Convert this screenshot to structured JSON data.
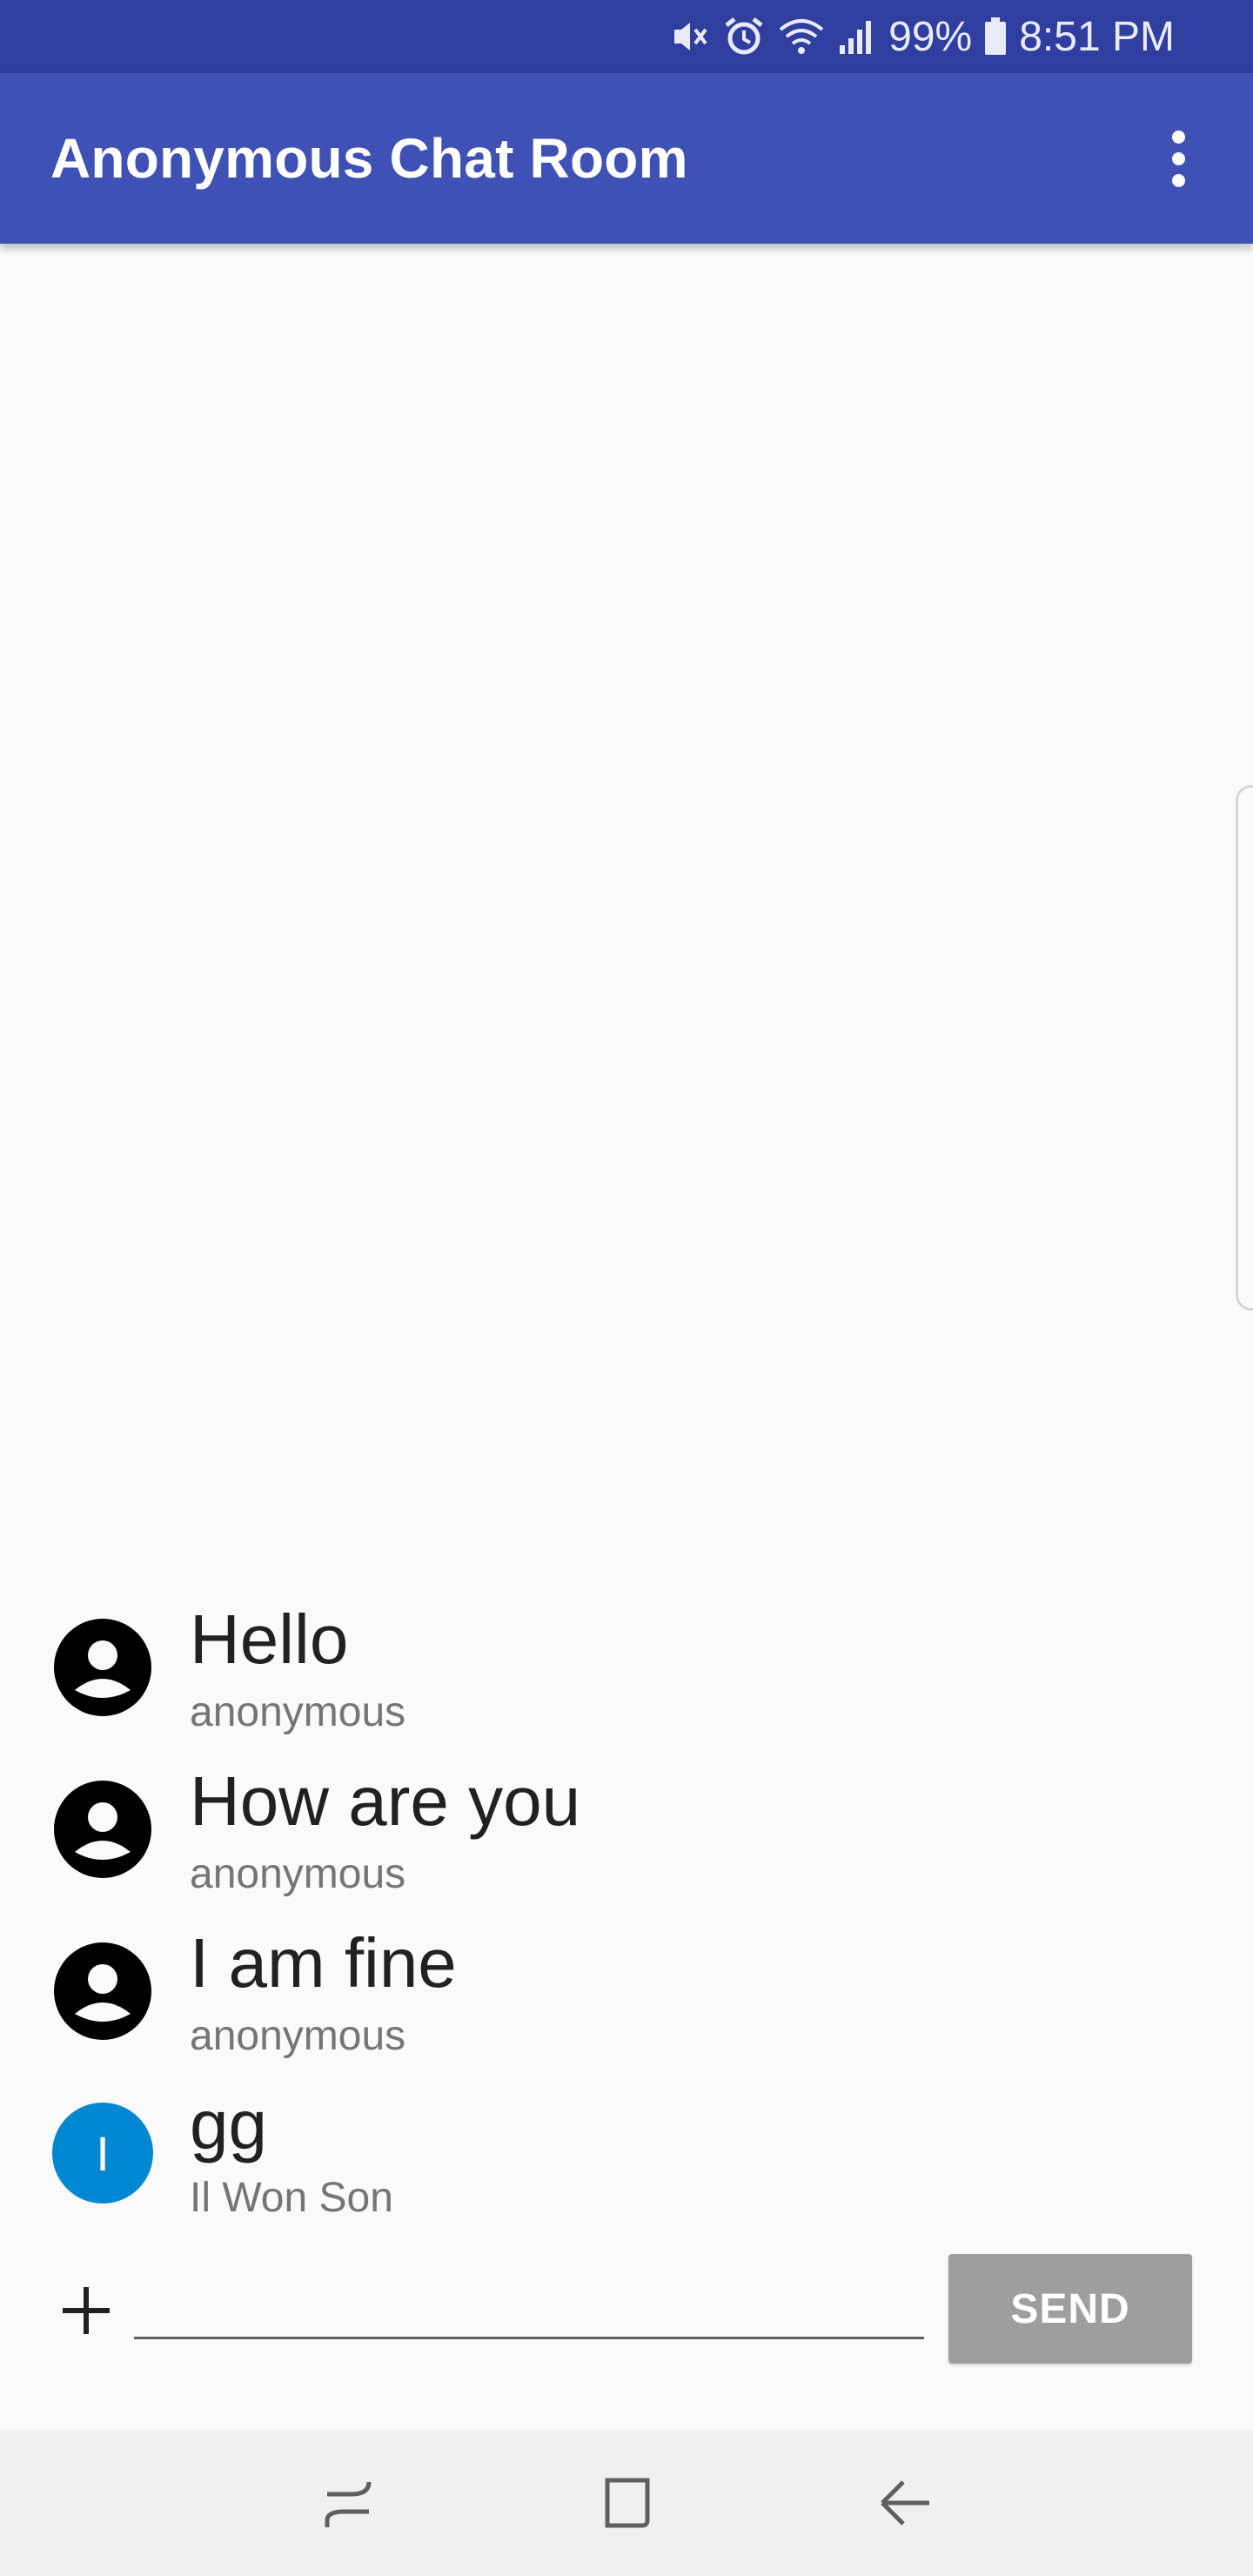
{
  "status_bar": {
    "battery_percent": "99%",
    "time": "8:51 PM",
    "icons": [
      "vibrate-mute-icon",
      "alarm-icon",
      "wifi-icon",
      "signal-icon",
      "battery-icon"
    ]
  },
  "app_bar": {
    "title": "Anonymous Chat Room",
    "menu_icon": "overflow-menu-icon"
  },
  "messages": [
    {
      "text": "Hello",
      "author": "anonymous",
      "avatar": "account-circle-icon"
    },
    {
      "text": "How are you",
      "author": "anonymous",
      "avatar": "account-circle-icon"
    },
    {
      "text": "I am fine",
      "author": "anonymous",
      "avatar": "account-circle-icon"
    },
    {
      "text": "gg",
      "author": "Il Won Son",
      "avatar_letter": "I",
      "avatar_color": "#0288d1"
    }
  ],
  "composer": {
    "input_value": "",
    "send_label": "SEND"
  },
  "nav_bar": {
    "icons": [
      "recent-apps-icon",
      "home-icon",
      "back-icon"
    ]
  },
  "colors": {
    "primary": "#3f51b5",
    "primary_dark": "#303f9f",
    "send_button": "#9e9e9e"
  }
}
